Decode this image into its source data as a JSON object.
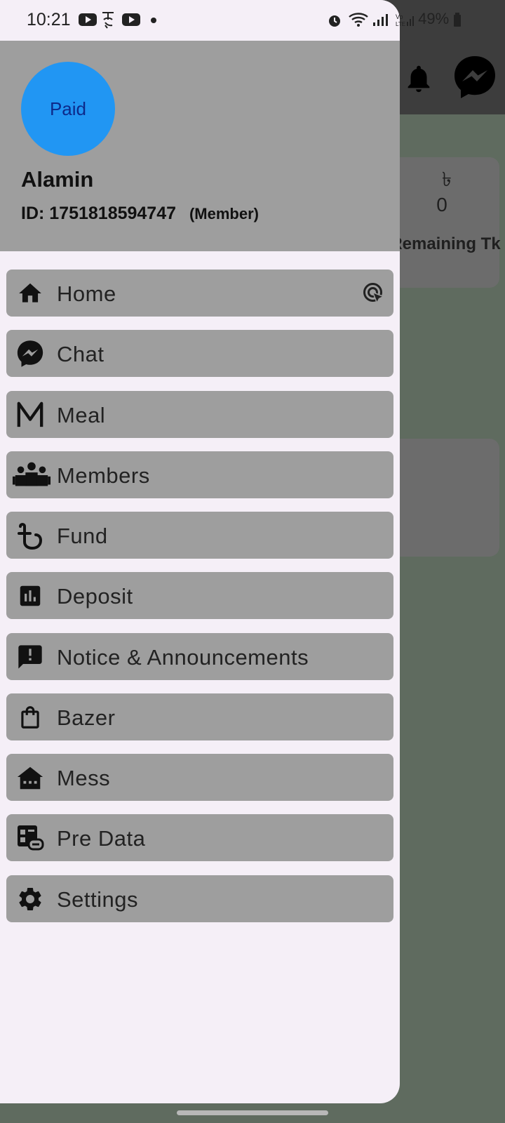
{
  "status_bar": {
    "time": "10:21",
    "right": "49%"
  },
  "profile": {
    "badge": "Paid",
    "name": "Alamin",
    "id_text": "ID: 1751818594747",
    "role": "(Member)"
  },
  "menu": [
    {
      "label": "Home",
      "icon": "home-icon"
    },
    {
      "label": "Chat",
      "icon": "messenger-icon"
    },
    {
      "label": "Meal",
      "icon": "meal-m-icon"
    },
    {
      "label": "Members",
      "icon": "members-icon"
    },
    {
      "label": "Fund",
      "icon": "taka-icon"
    },
    {
      "label": "Deposit",
      "icon": "bar-chart-icon"
    },
    {
      "label": "Notice & Announcements",
      "icon": "announcement-icon"
    },
    {
      "label": "Bazer",
      "icon": "shopping-bag-icon"
    },
    {
      "label": "Mess",
      "icon": "house-icon"
    },
    {
      "label": "Pre Data",
      "icon": "pre-data-icon"
    },
    {
      "label": "Settings",
      "icon": "gear-icon"
    }
  ],
  "background": {
    "currency_symbol": "৳",
    "amount": "0",
    "caption": "Remaining Tk"
  },
  "colors": {
    "drawer_bg": "#f5eff7",
    "header_bg": "#9e9e9e",
    "menu_item_bg": "#9e9e9e",
    "avatar_bg": "#2196f3",
    "scrim_bg": "#5f6b5f"
  }
}
